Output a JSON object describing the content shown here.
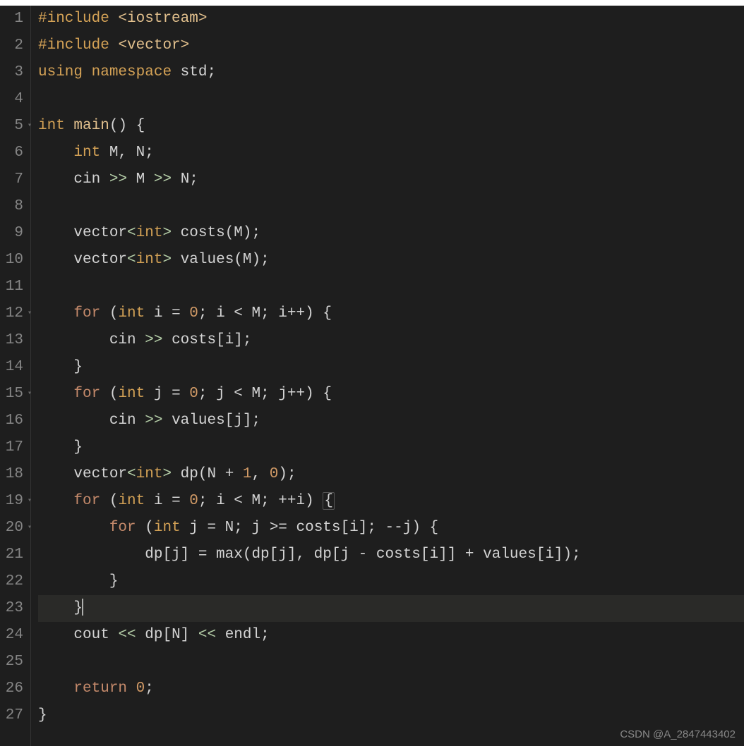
{
  "gutter": {
    "lines": [
      "1",
      "2",
      "3",
      "4",
      "5",
      "6",
      "7",
      "8",
      "9",
      "10",
      "11",
      "12",
      "13",
      "14",
      "15",
      "16",
      "17",
      "18",
      "19",
      "20",
      "21",
      "22",
      "23",
      "24",
      "25",
      "26",
      "27"
    ],
    "foldable": [
      5,
      12,
      15,
      19,
      20
    ]
  },
  "code": {
    "l1": {
      "p1": "#include",
      "p2": " ",
      "p3": "<iostream>"
    },
    "l2": {
      "p1": "#include",
      "p2": " ",
      "p3": "<vector>"
    },
    "l3": {
      "p1": "using",
      "p2": " ",
      "p3": "namespace",
      "p4": " ",
      "p5": "std",
      "p6": ";"
    },
    "l4": "",
    "l5": {
      "p1": "int",
      "p2": " ",
      "p3": "main",
      "p4": "()",
      "p5": " {"
    },
    "l6": {
      "p0": "    ",
      "p1": "int",
      "p2": " M, N;"
    },
    "l7": {
      "p0": "    ",
      "p1": "cin ",
      "p2": ">>",
      "p3": " M ",
      "p4": ">>",
      "p5": " N;"
    },
    "l8": "",
    "l9": {
      "p0": "    ",
      "p1": "vector",
      "p2": "<",
      "p3": "int",
      "p4": ">",
      "p5": " costs(M);"
    },
    "l10": {
      "p0": "    ",
      "p1": "vector",
      "p2": "<",
      "p3": "int",
      "p4": ">",
      "p5": " values(M);"
    },
    "l11": "",
    "l12": {
      "p0": "    ",
      "p1": "for",
      "p2": " (",
      "p3": "int",
      "p4": " i = ",
      "p5": "0",
      "p6": "; i < M; i++) {"
    },
    "l13": {
      "p0": "        ",
      "p1": "cin ",
      "p2": ">>",
      "p3": " costs[i];"
    },
    "l14": {
      "p0": "    ",
      "p1": "}"
    },
    "l15": {
      "p0": "    ",
      "p1": "for",
      "p2": " (",
      "p3": "int",
      "p4": " j = ",
      "p5": "0",
      "p6": "; j < M; j++) {"
    },
    "l16": {
      "p0": "        ",
      "p1": "cin ",
      "p2": ">>",
      "p3": " values[j];"
    },
    "l17": {
      "p0": "    ",
      "p1": "}"
    },
    "l18": {
      "p0": "    ",
      "p1": "vector",
      "p2": "<",
      "p3": "int",
      "p4": ">",
      "p5": " dp(N + ",
      "p6": "1",
      "p7": ", ",
      "p8": "0",
      "p9": ");"
    },
    "l19": {
      "p0": "    ",
      "p1": "for",
      "p2": " (",
      "p3": "int",
      "p4": " i = ",
      "p5": "0",
      "p6": "; i < M; ++i) ",
      "p7": "{"
    },
    "l20": {
      "p0": "        ",
      "p1": "for",
      "p2": " (",
      "p3": "int",
      "p4": " j = N; j >= costs[i]; --j) {"
    },
    "l21": {
      "p0": "            ",
      "p1": "dp[j] = max(dp[j], dp[j - costs[i]] + values[i]);"
    },
    "l22": {
      "p0": "        ",
      "p1": "}"
    },
    "l23": {
      "p0": "    ",
      "p1": "}"
    },
    "l24": {
      "p0": "    ",
      "p1": "cout ",
      "p2": "<<",
      "p3": " dp[N] ",
      "p4": "<<",
      "p5": " endl;"
    },
    "l25": "",
    "l26": {
      "p0": "    ",
      "p1": "return",
      "p2": " ",
      "p3": "0",
      "p4": ";"
    },
    "l27": {
      "p1": "}"
    }
  },
  "watermark": "CSDN @A_2847443402"
}
